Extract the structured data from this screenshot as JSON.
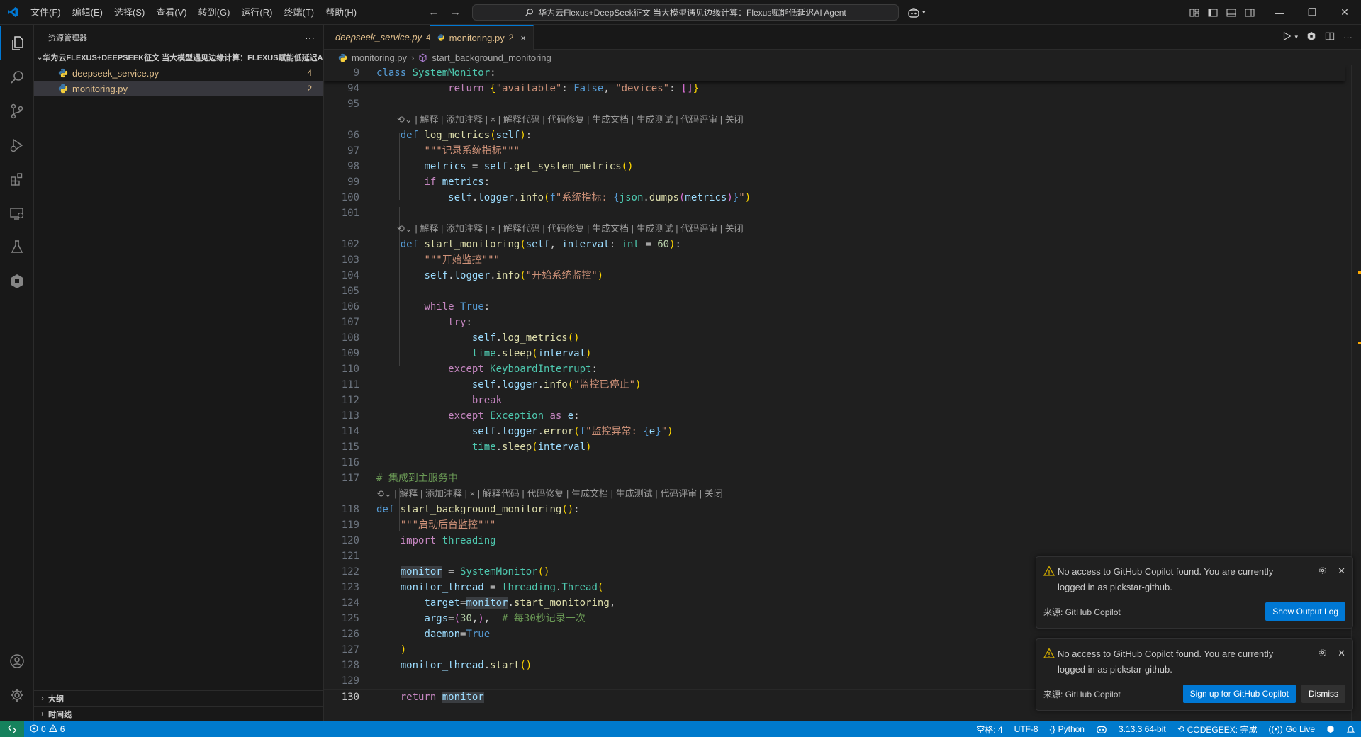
{
  "titlebar": {
    "menu": [
      "文件(F)",
      "编辑(E)",
      "选择(S)",
      "查看(V)",
      "转到(G)",
      "运行(R)",
      "终端(T)",
      "帮助(H)"
    ],
    "search_text": "华为云Flexus+DeepSeek征文 当大模型遇见边缘计算：Flexus赋能低延迟AI Agent"
  },
  "sidebar": {
    "title": "资源管理器",
    "more": "···",
    "folder": "华为云FLEXUS+DEEPSEEK征文 当大模型遇见边缘计算：FLEXUS赋能低延迟A...",
    "files": [
      {
        "name": "deepseek_service.py",
        "badge": "4"
      },
      {
        "name": "monitoring.py",
        "badge": "2"
      }
    ],
    "outline": "大纲",
    "timeline": "时间线"
  },
  "tabs": [
    {
      "name": "deepseek_service.py",
      "badge": "4"
    },
    {
      "name": "monitoring.py",
      "badge": "2",
      "close": "×"
    }
  ],
  "breadcrumb": {
    "file": "monitoring.py",
    "sep": "›",
    "symbol": "start_background_monitoring"
  },
  "codelens": "| 解释 | 添加注释 | × | 解释代码 | 代码修复 | 生成文档 | 生成测试 | 代码评审 | 关闭",
  "sticky": {
    "num": "9"
  },
  "lines": {
    "l94": "94",
    "l95": "95",
    "l96": "96",
    "l97": "97",
    "l98": "98",
    "l99": "99",
    "l100": "100",
    "l101": "101",
    "l102": "102",
    "l103": "103",
    "l104": "104",
    "l105": "105",
    "l106": "106",
    "l107": "107",
    "l108": "108",
    "l109": "109",
    "l110": "110",
    "l111": "111",
    "l112": "112",
    "l113": "113",
    "l114": "114",
    "l115": "115",
    "l116": "116",
    "l117": "117",
    "l118": "118",
    "l119": "119",
    "l120": "120",
    "l121": "121",
    "l122": "122",
    "l123": "123",
    "l124": "124",
    "l125": "125",
    "l126": "126",
    "l127": "127",
    "l128": "128",
    "l129": "129",
    "l130": "130"
  },
  "notifications": [
    {
      "message": "No access to GitHub Copilot found. You are currently logged in as pickstar-github.",
      "source": "来源: GitHub Copilot",
      "primary": "Show Output Log"
    },
    {
      "message": "No access to GitHub Copilot found. You are currently logged in as pickstar-github.",
      "source": "来源: GitHub Copilot",
      "primary": "Sign up for GitHub Copilot",
      "secondary": "Dismiss"
    }
  ],
  "statusbar": {
    "errors": "0",
    "warnings": "6",
    "spaces": "空格: 4",
    "encoding": "UTF-8",
    "language": "Python",
    "interpreter": "3.13.3 64-bit",
    "codegeex": "CODEGEEX: 完成",
    "golive": "Go Live"
  },
  "colors": {
    "accent": "#0078d4",
    "statusbar": "#007acc",
    "modified": "#e2c08d"
  }
}
